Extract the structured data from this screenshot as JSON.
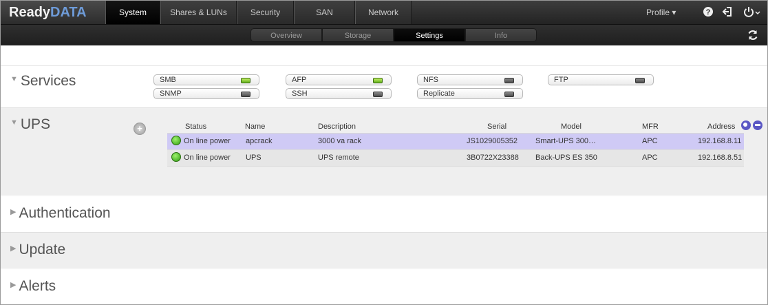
{
  "app": {
    "logo_ready": "Ready",
    "logo_data": "DATA"
  },
  "main_tabs": [
    {
      "label": "System"
    },
    {
      "label": "Shares & LUNs"
    },
    {
      "label": "Security"
    },
    {
      "label": "SAN"
    },
    {
      "label": "Network"
    }
  ],
  "header": {
    "profile_label": "Profile ▾",
    "help_icon": "help-icon",
    "logout_icon": "logout-icon",
    "power_icon": "power-icon"
  },
  "sub_tabs": [
    {
      "label": "Overview"
    },
    {
      "label": "Storage"
    },
    {
      "label": "Settings"
    },
    {
      "label": "Info"
    }
  ],
  "sections": {
    "services": "Services",
    "ups": "UPS",
    "authentication": "Authentication",
    "update": "Update",
    "alerts": "Alerts"
  },
  "services": [
    {
      "name": "SMB",
      "status": "on"
    },
    {
      "name": "AFP",
      "status": "on"
    },
    {
      "name": "NFS",
      "status": "off"
    },
    {
      "name": "FTP",
      "status": "off"
    },
    {
      "name": "SNMP",
      "status": "off"
    },
    {
      "name": "SSH",
      "status": "off"
    },
    {
      "name": "Replicate",
      "status": "off"
    }
  ],
  "ups_table": {
    "headers": {
      "status": "Status",
      "name": "Name",
      "description": "Description",
      "serial": "Serial",
      "model": "Model",
      "mfr": "MFR",
      "address": "Address"
    },
    "rows": [
      {
        "status": "On line power",
        "name": "apcrack",
        "description": "3000 va rack",
        "serial": "JS1029005352",
        "model": "Smart-UPS 300…",
        "mfr": "APC",
        "address": "192.168.8.11"
      },
      {
        "status": "On line power",
        "name": "UPS",
        "description": "UPS remote",
        "serial": "3B0722X23388",
        "model": "Back-UPS ES 350",
        "mfr": "APC",
        "address": "192.168.8.51"
      }
    ]
  },
  "colors": {
    "accent": "#5a57c4",
    "selected_row": "#cfcaf5",
    "led_on": "#6cc21f",
    "logo_data": "#6e9bd8"
  }
}
